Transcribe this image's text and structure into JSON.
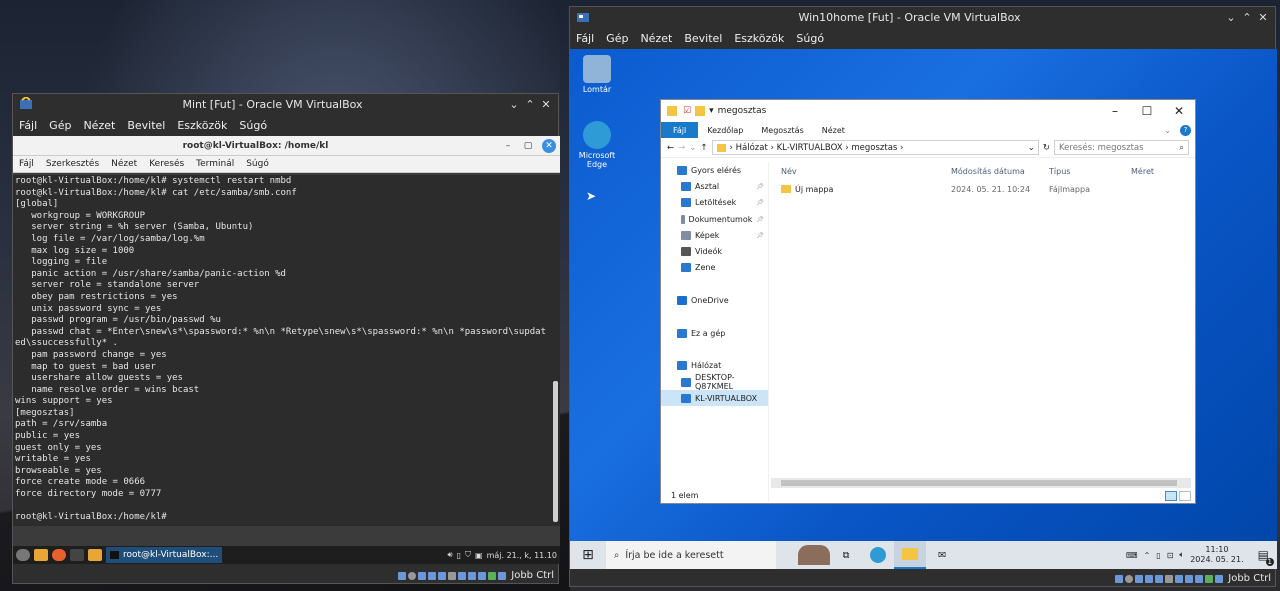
{
  "mint": {
    "title": "Mint [Fut] - Oracle VM VirtualBox",
    "menu": [
      "Fájl",
      "Gép",
      "Nézet",
      "Bevitel",
      "Eszközök",
      "Súgó"
    ],
    "terminal": {
      "title": "root@kl-VirtualBox: /home/kl",
      "menu": [
        "Fájl",
        "Szerkesztés",
        "Nézet",
        "Keresés",
        "Terminál",
        "Súgó"
      ],
      "lines": [
        "root@kl-VirtualBox:/home/kl# systemctl restart nmbd",
        "root@kl-VirtualBox:/home/kl# cat /etc/samba/smb.conf",
        "[global]",
        "   workgroup = WORKGROUP",
        "   server string = %h server (Samba, Ubuntu)",
        "   log file = /var/log/samba/log.%m",
        "   max log size = 1000",
        "   logging = file",
        "   panic action = /usr/share/samba/panic-action %d",
        "   server role = standalone server",
        "   obey pam restrictions = yes",
        "   unix password sync = yes",
        "   passwd program = /usr/bin/passwd %u",
        "   passwd chat = *Enter\\snew\\s*\\spassword:* %n\\n *Retype\\snew\\s*\\spassword:* %n\\n *password\\supdat",
        "ed\\ssuccessfully* .",
        "   pam password change = yes",
        "   map to guest = bad user",
        "   usershare allow guests = yes",
        "   name resolve order = wins bcast",
        "wins support = yes",
        "[megosztas]",
        "path = /srv/samba",
        "public = yes",
        "guest only = yes",
        "writable = yes",
        "browseable = yes",
        "force create mode = 0666",
        "force directory mode = 0777",
        "",
        "root@kl-VirtualBox:/home/kl#"
      ]
    },
    "panel": {
      "task_label": "root@kl-VirtualBox:...",
      "clock": "máj. 21., k, 11.10"
    },
    "status_key": "Jobb Ctrl"
  },
  "win": {
    "title": "Win10home [Fut] - Oracle VM VirtualBox",
    "menu": [
      "Fájl",
      "Gép",
      "Nézet",
      "Bevitel",
      "Eszközök",
      "Súgó"
    ],
    "desktop_icons": [
      {
        "label": "Lomtár",
        "icon": "recycle-bin-icon",
        "color": "#8fb4d8"
      },
      {
        "label": "Microsoft Edge",
        "icon": "edge-icon",
        "color": "#2e9bd6"
      }
    ],
    "explorer": {
      "title": "megosztas",
      "ribbon": {
        "file": "Fájl",
        "tabs": [
          "Kezdőlap",
          "Megosztás",
          "Nézet"
        ]
      },
      "path": [
        "Hálózat",
        "KL-VIRTUALBOX",
        "megosztas"
      ],
      "search_placeholder": "Keresés: megosztas",
      "nav": [
        {
          "label": "Gyors elérés",
          "icon": "star-icon",
          "color": "#2a78d0",
          "top": true
        },
        {
          "label": "Asztal",
          "icon": "desktop-icon",
          "color": "#2a78d0",
          "pin": true
        },
        {
          "label": "Letöltések",
          "icon": "download-icon",
          "color": "#2a78d0",
          "pin": true
        },
        {
          "label": "Dokumentumok",
          "icon": "document-icon",
          "color": "#7f8ea0",
          "pin": true
        },
        {
          "label": "Képek",
          "icon": "pictures-icon",
          "color": "#7f8ea0",
          "pin": true
        },
        {
          "label": "Videók",
          "icon": "video-icon",
          "color": "#555"
        },
        {
          "label": "Zene",
          "icon": "music-icon",
          "color": "#2a78d0"
        },
        {
          "label": "",
          "icon": "spacer",
          "color": "transparent"
        },
        {
          "label": "OneDrive",
          "icon": "cloud-icon",
          "color": "#1b6fd0",
          "top": true
        },
        {
          "label": "",
          "icon": "spacer",
          "color": "transparent"
        },
        {
          "label": "Ez a gép",
          "icon": "computer-icon",
          "color": "#2a78d0",
          "top": true
        },
        {
          "label": "",
          "icon": "spacer",
          "color": "transparent"
        },
        {
          "label": "Hálózat",
          "icon": "network-icon",
          "color": "#2a78d0",
          "top": true
        },
        {
          "label": "DESKTOP-Q87KMEL",
          "icon": "computer-icon",
          "color": "#2a78d0"
        },
        {
          "label": "KL-VIRTUALBOX",
          "icon": "computer-icon",
          "color": "#2a78d0",
          "selected": true
        }
      ],
      "columns": [
        "Név",
        "Módosítás dátuma",
        "Típus",
        "Méret"
      ],
      "rows": [
        {
          "name": "Új mappa",
          "date": "2024. 05. 21. 10:24",
          "type": "Fájlmappa",
          "size": ""
        }
      ],
      "status": "1 elem"
    },
    "taskbar": {
      "search_placeholder": "Írja be ide a keresett",
      "time": "11:10",
      "date": "2024. 05. 21.",
      "badge": "1"
    },
    "status_key": "Jobb Ctrl"
  }
}
